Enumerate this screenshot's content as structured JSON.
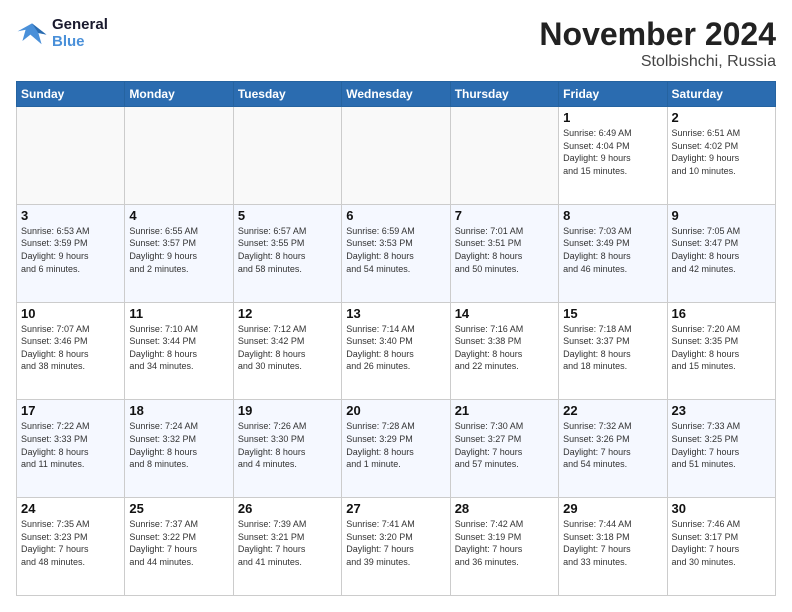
{
  "logo": {
    "line1": "General",
    "line2": "Blue"
  },
  "title": "November 2024",
  "location": "Stolbishchi, Russia",
  "days_header": [
    "Sunday",
    "Monday",
    "Tuesday",
    "Wednesday",
    "Thursday",
    "Friday",
    "Saturday"
  ],
  "weeks": [
    [
      {
        "day": "",
        "info": ""
      },
      {
        "day": "",
        "info": ""
      },
      {
        "day": "",
        "info": ""
      },
      {
        "day": "",
        "info": ""
      },
      {
        "day": "",
        "info": ""
      },
      {
        "day": "1",
        "info": "Sunrise: 6:49 AM\nSunset: 4:04 PM\nDaylight: 9 hours\nand 15 minutes."
      },
      {
        "day": "2",
        "info": "Sunrise: 6:51 AM\nSunset: 4:02 PM\nDaylight: 9 hours\nand 10 minutes."
      }
    ],
    [
      {
        "day": "3",
        "info": "Sunrise: 6:53 AM\nSunset: 3:59 PM\nDaylight: 9 hours\nand 6 minutes."
      },
      {
        "day": "4",
        "info": "Sunrise: 6:55 AM\nSunset: 3:57 PM\nDaylight: 9 hours\nand 2 minutes."
      },
      {
        "day": "5",
        "info": "Sunrise: 6:57 AM\nSunset: 3:55 PM\nDaylight: 8 hours\nand 58 minutes."
      },
      {
        "day": "6",
        "info": "Sunrise: 6:59 AM\nSunset: 3:53 PM\nDaylight: 8 hours\nand 54 minutes."
      },
      {
        "day": "7",
        "info": "Sunrise: 7:01 AM\nSunset: 3:51 PM\nDaylight: 8 hours\nand 50 minutes."
      },
      {
        "day": "8",
        "info": "Sunrise: 7:03 AM\nSunset: 3:49 PM\nDaylight: 8 hours\nand 46 minutes."
      },
      {
        "day": "9",
        "info": "Sunrise: 7:05 AM\nSunset: 3:47 PM\nDaylight: 8 hours\nand 42 minutes."
      }
    ],
    [
      {
        "day": "10",
        "info": "Sunrise: 7:07 AM\nSunset: 3:46 PM\nDaylight: 8 hours\nand 38 minutes."
      },
      {
        "day": "11",
        "info": "Sunrise: 7:10 AM\nSunset: 3:44 PM\nDaylight: 8 hours\nand 34 minutes."
      },
      {
        "day": "12",
        "info": "Sunrise: 7:12 AM\nSunset: 3:42 PM\nDaylight: 8 hours\nand 30 minutes."
      },
      {
        "day": "13",
        "info": "Sunrise: 7:14 AM\nSunset: 3:40 PM\nDaylight: 8 hours\nand 26 minutes."
      },
      {
        "day": "14",
        "info": "Sunrise: 7:16 AM\nSunset: 3:38 PM\nDaylight: 8 hours\nand 22 minutes."
      },
      {
        "day": "15",
        "info": "Sunrise: 7:18 AM\nSunset: 3:37 PM\nDaylight: 8 hours\nand 18 minutes."
      },
      {
        "day": "16",
        "info": "Sunrise: 7:20 AM\nSunset: 3:35 PM\nDaylight: 8 hours\nand 15 minutes."
      }
    ],
    [
      {
        "day": "17",
        "info": "Sunrise: 7:22 AM\nSunset: 3:33 PM\nDaylight: 8 hours\nand 11 minutes."
      },
      {
        "day": "18",
        "info": "Sunrise: 7:24 AM\nSunset: 3:32 PM\nDaylight: 8 hours\nand 8 minutes."
      },
      {
        "day": "19",
        "info": "Sunrise: 7:26 AM\nSunset: 3:30 PM\nDaylight: 8 hours\nand 4 minutes."
      },
      {
        "day": "20",
        "info": "Sunrise: 7:28 AM\nSunset: 3:29 PM\nDaylight: 8 hours\nand 1 minute."
      },
      {
        "day": "21",
        "info": "Sunrise: 7:30 AM\nSunset: 3:27 PM\nDaylight: 7 hours\nand 57 minutes."
      },
      {
        "day": "22",
        "info": "Sunrise: 7:32 AM\nSunset: 3:26 PM\nDaylight: 7 hours\nand 54 minutes."
      },
      {
        "day": "23",
        "info": "Sunrise: 7:33 AM\nSunset: 3:25 PM\nDaylight: 7 hours\nand 51 minutes."
      }
    ],
    [
      {
        "day": "24",
        "info": "Sunrise: 7:35 AM\nSunset: 3:23 PM\nDaylight: 7 hours\nand 48 minutes."
      },
      {
        "day": "25",
        "info": "Sunrise: 7:37 AM\nSunset: 3:22 PM\nDaylight: 7 hours\nand 44 minutes."
      },
      {
        "day": "26",
        "info": "Sunrise: 7:39 AM\nSunset: 3:21 PM\nDaylight: 7 hours\nand 41 minutes."
      },
      {
        "day": "27",
        "info": "Sunrise: 7:41 AM\nSunset: 3:20 PM\nDaylight: 7 hours\nand 39 minutes."
      },
      {
        "day": "28",
        "info": "Sunrise: 7:42 AM\nSunset: 3:19 PM\nDaylight: 7 hours\nand 36 minutes."
      },
      {
        "day": "29",
        "info": "Sunrise: 7:44 AM\nSunset: 3:18 PM\nDaylight: 7 hours\nand 33 minutes."
      },
      {
        "day": "30",
        "info": "Sunrise: 7:46 AM\nSunset: 3:17 PM\nDaylight: 7 hours\nand 30 minutes."
      }
    ]
  ]
}
